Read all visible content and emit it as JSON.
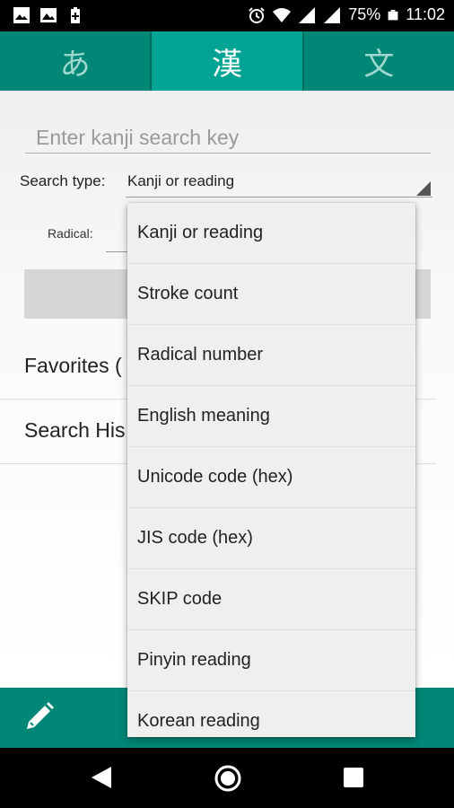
{
  "status_bar": {
    "battery": "75%",
    "time": "11:02",
    "icons": [
      "photo-icon",
      "image-icon",
      "battery-saver-icon",
      "alarm-icon",
      "wifi-icon",
      "signal-icon",
      "signal-icon",
      "battery-icon"
    ]
  },
  "tabs": [
    {
      "label": "あ",
      "active": false
    },
    {
      "label": "漢",
      "active": true
    },
    {
      "label": "文",
      "active": false
    }
  ],
  "search": {
    "placeholder": "Enter kanji search key",
    "value": ""
  },
  "search_type": {
    "label": "Search type:",
    "selected": "Kanji or reading"
  },
  "radical": {
    "label": "Radical:"
  },
  "list": {
    "favorites": "Favorites (",
    "history": "Search His"
  },
  "dropdown": {
    "options": [
      "Kanji or reading",
      "Stroke count",
      "Radical number",
      "English meaning",
      "Unicode code (hex)",
      "JIS code (hex)",
      "SKIP code",
      "Pinyin reading",
      "Korean reading"
    ]
  },
  "colors": {
    "primary": "#008776",
    "tab_active": "#00a394"
  }
}
